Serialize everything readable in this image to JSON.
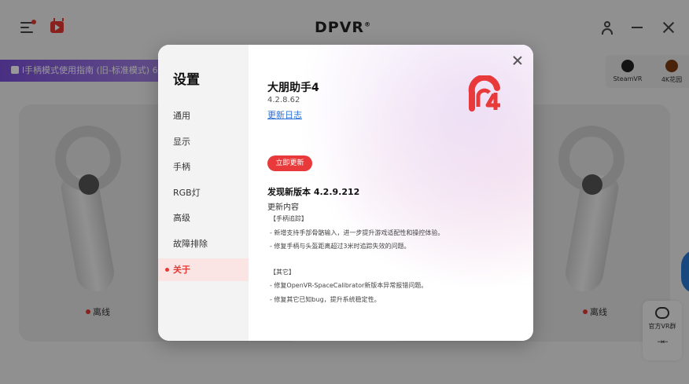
{
  "app": {
    "logo_text": "DPVR",
    "logo_mark": "®",
    "guide_banner": "l手柄模式使用指南 (旧-标准模式) 6/",
    "shortcuts": [
      {
        "label": "SteamVR",
        "icon": "steam-icon"
      },
      {
        "label": "4K花园",
        "icon": "flower-icon"
      }
    ],
    "left_status": "离线",
    "right_status": "离线",
    "side_panel_label": "官方VR群",
    "side_panel_collapse": "→←"
  },
  "settings": {
    "title": "设置",
    "nav": [
      "通用",
      "显示",
      "手柄",
      "RGB灯",
      "高级",
      "故障排除",
      "关于"
    ],
    "active_nav": "关于"
  },
  "about": {
    "app_name": "大朋助手4",
    "version": "4.2.8.62",
    "changelog_link": "更新日志",
    "update_button": "立即更新",
    "new_version": "发现新版本 4.2.9.212",
    "content_title": "更新内容",
    "notes": [
      "【手柄追踪】",
      "- 新增支持手部骨骼输入，进一步提升游戏适配性和操控体验。",
      "- 修复手柄与头盔距离超过3米时追踪失效的问题。",
      "【其它】",
      "- 修复OpenVR-SpaceCalibrator新版本异常报错问题。",
      "- 修复其它已知bug，提升系统稳定性。"
    ]
  },
  "colors": {
    "accent": "#e53935",
    "link": "#2a6fd6",
    "banner": "#7b4fd9"
  }
}
